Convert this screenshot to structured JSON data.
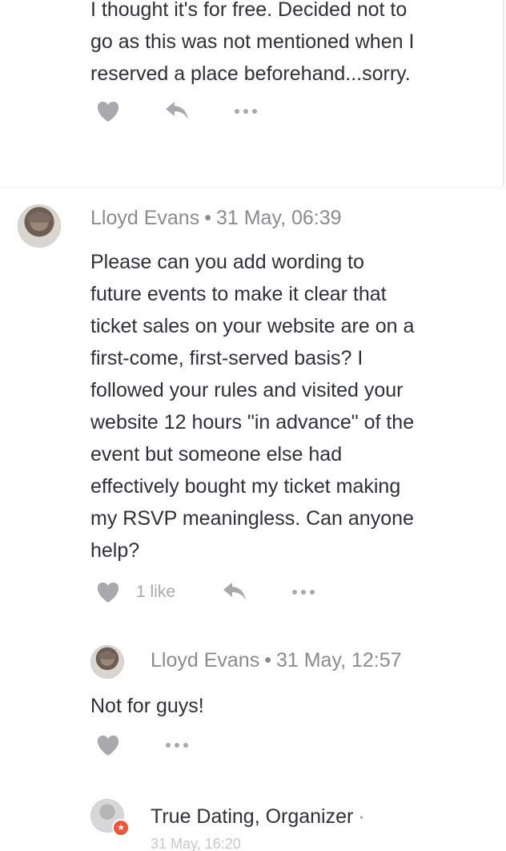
{
  "top_comment": {
    "text": "I thought it's for free. Decided not to\ngo as this was not mentioned when I\nreserved a place beforehand...sorry."
  },
  "comment": {
    "author": "Lloyd Evans",
    "timestamp": "31 May, 06:39",
    "text": "Please can you add wording to\nfuture events to make it clear that\nticket sales on your website are on a\nfirst-come, first-served basis? I\nfollowed your rules and visited your\nwebsite 12 hours \"in advance\" of the\nevent but someone else had\neffectively bought my ticket making\nmy RSVP meaningless. Can anyone\nhelp?",
    "likes": "1 like"
  },
  "reply": {
    "author": "Lloyd Evans",
    "timestamp": "31 May, 12:57",
    "text": "Not for guys!"
  },
  "organizer_reply": {
    "author": "True Dating, Organizer",
    "separator": "·",
    "timestamp_partial": "31 May, 16:20"
  },
  "separator": "•",
  "icons": {
    "like": "heart-icon",
    "reply": "reply-arrow-icon",
    "more": "more-dots-icon",
    "organizer_badge": "organizer-star-icon"
  },
  "colors": {
    "text": "#2f3038",
    "meta": "#8a8b90",
    "icon": "#a8a9ad",
    "badge": "#f05537"
  }
}
